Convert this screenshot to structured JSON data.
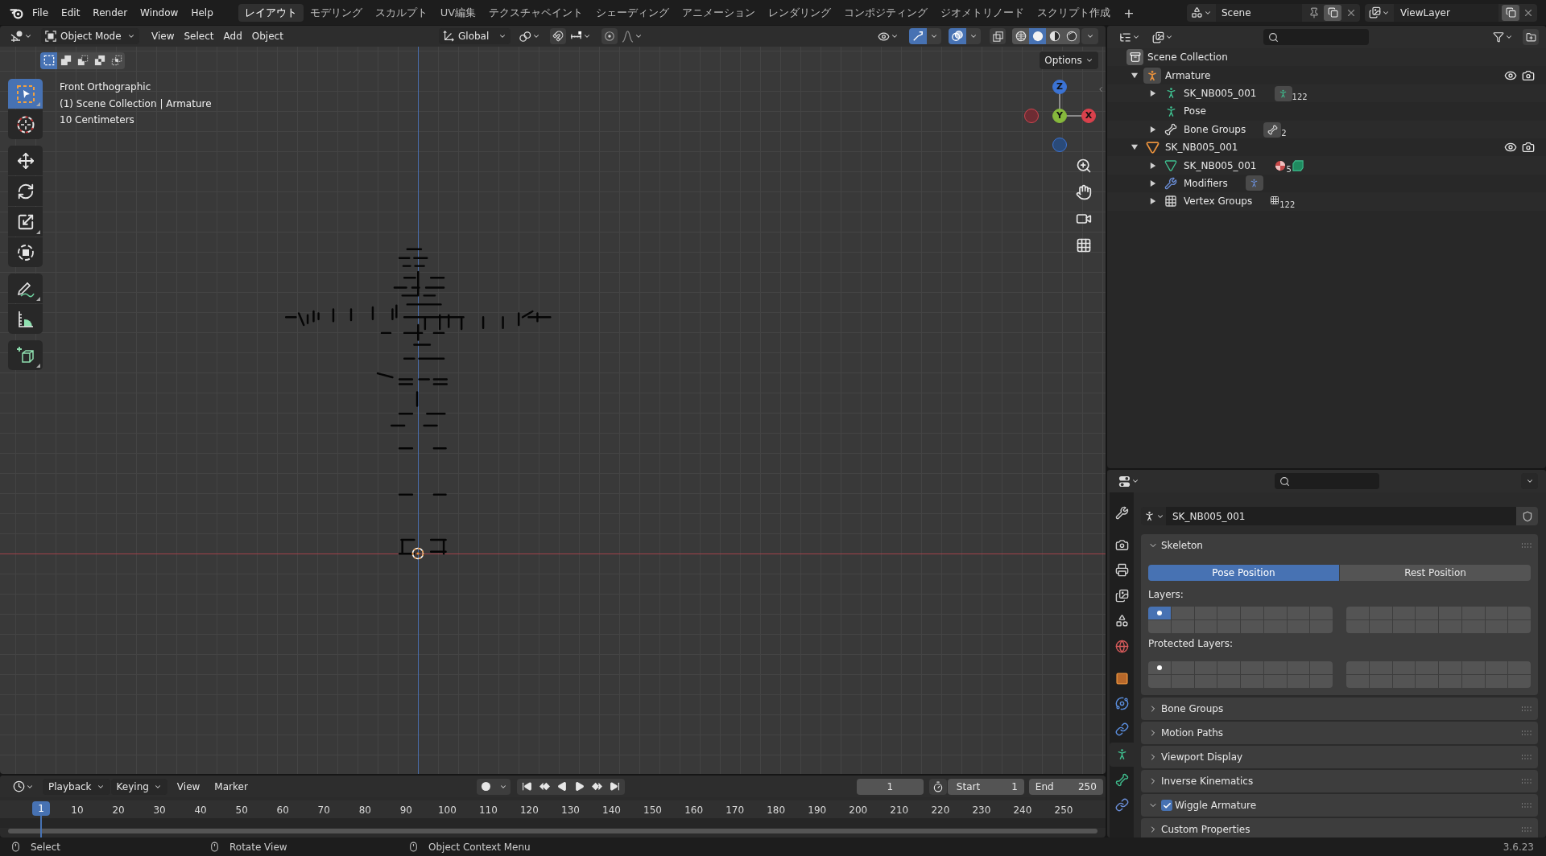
{
  "top_bar": {
    "menus": [
      "File",
      "Edit",
      "Render",
      "Window",
      "Help"
    ],
    "workspaces": [
      {
        "label": "レイアウト",
        "selected": true
      },
      {
        "label": "モデリング",
        "selected": false
      },
      {
        "label": "スカルプト",
        "selected": false
      },
      {
        "label": "UV編集",
        "selected": false
      },
      {
        "label": "テクスチャペイント",
        "selected": false
      },
      {
        "label": "シェーディング",
        "selected": false
      },
      {
        "label": "アニメーション",
        "selected": false
      },
      {
        "label": "レンダリング",
        "selected": false
      },
      {
        "label": "コンポジティング",
        "selected": false
      },
      {
        "label": "ジオメトリノード",
        "selected": false
      },
      {
        "label": "スクリプト作成",
        "selected": false
      }
    ],
    "add_workspace": "+",
    "scene": "Scene",
    "view_layer": "ViewLayer"
  },
  "viewport": {
    "header": {
      "mode": "Object Mode",
      "menus": [
        "View",
        "Select",
        "Add",
        "Object"
      ],
      "orientation": "Global",
      "gizmos_on": true,
      "overlays_on": true,
      "xray_on": false,
      "shading": [
        {
          "kind": "wireframe",
          "selected": false
        },
        {
          "kind": "solid",
          "selected": true
        },
        {
          "kind": "material",
          "selected": false
        },
        {
          "kind": "rendered",
          "selected": false
        }
      ]
    },
    "select_modes": [
      {
        "kind": "set",
        "selected": true
      },
      {
        "kind": "extend",
        "selected": false
      },
      {
        "kind": "subtract",
        "selected": false
      },
      {
        "kind": "invert",
        "selected": false
      },
      {
        "kind": "intersect",
        "selected": false
      }
    ],
    "options": "Options",
    "tool_groups": [
      {
        "tools": [
          {
            "kind": "select_box",
            "selected": true,
            "more": true
          },
          {
            "kind": "cursor",
            "selected": false,
            "more": false
          }
        ]
      },
      {
        "tools": [
          {
            "kind": "move",
            "selected": false,
            "more": false
          },
          {
            "kind": "rotate",
            "selected": false,
            "more": false
          },
          {
            "kind": "scale",
            "selected": false,
            "more": true
          },
          {
            "kind": "transform",
            "selected": false,
            "more": false
          }
        ]
      },
      {
        "tools": [
          {
            "kind": "annotate",
            "selected": false,
            "more": true
          },
          {
            "kind": "measure",
            "selected": false,
            "more": false
          }
        ]
      },
      {
        "tools": [
          {
            "kind": "add_cube",
            "selected": false,
            "more": true
          }
        ]
      }
    ],
    "overlay_text": [
      "Front Orthographic",
      "(1) Scene Collection | Armature",
      "10 Centimeters"
    ],
    "gizmo_axes": [
      {
        "kind": "z",
        "label": "Z"
      },
      {
        "kind": "neg_x"
      },
      {
        "kind": "y",
        "label": "Y"
      },
      {
        "kind": "x",
        "label": "X"
      },
      {
        "kind": "neg_z"
      }
    ]
  },
  "timeline": {
    "menus": [
      {
        "label": "Playback",
        "kind": "dropdown"
      },
      {
        "label": "Keying",
        "kind": "dropdown"
      },
      {
        "label": "View",
        "kind": "plain"
      },
      {
        "label": "Marker",
        "kind": "plain"
      }
    ],
    "auto_keying": false,
    "current_frame": "1",
    "start_label": "Start",
    "start": "1",
    "end_label": "End",
    "end": "250",
    "playhead": "1",
    "ruler_labels": [
      "10",
      "20",
      "30",
      "40",
      "50",
      "60",
      "70",
      "80",
      "90",
      "100",
      "110",
      "120",
      "130",
      "140",
      "150",
      "160",
      "170",
      "180",
      "190",
      "200",
      "210",
      "220",
      "230",
      "240",
      "250"
    ]
  },
  "status_bar": {
    "hints": [
      "Select",
      "Rotate View",
      "Object Context Menu"
    ],
    "version": "3.6.23"
  },
  "outliner": {
    "root": "Scene Collection",
    "items": [
      {
        "kind": "armature_object",
        "name": "Armature",
        "expanded": true,
        "visible": true,
        "renderable": true,
        "children": [
          {
            "kind": "armature_data",
            "name": "SK_NB005_001",
            "expanded": false,
            "badge": "122"
          },
          {
            "kind": "pose",
            "name": "Pose"
          },
          {
            "kind": "bone_groups",
            "name": "Bone Groups",
            "expanded": false,
            "badge": "2"
          }
        ]
      },
      {
        "kind": "mesh_object",
        "name": "SK_NB005_001",
        "expanded": true,
        "visible": true,
        "renderable": true,
        "children": [
          {
            "kind": "mesh_data",
            "name": "SK_NB005_001",
            "expanded": false,
            "badge": "5"
          },
          {
            "kind": "modifiers",
            "name": "Modifiers",
            "expanded": false
          },
          {
            "kind": "vertex_groups",
            "name": "Vertex Groups",
            "expanded": false,
            "badge": "122"
          }
        ]
      }
    ]
  },
  "properties": {
    "tab_groups": [
      {
        "tabs": [
          {
            "kind": "tool",
            "selected": false
          }
        ]
      },
      {
        "tabs": [
          {
            "kind": "render",
            "selected": false
          },
          {
            "kind": "output",
            "selected": false
          },
          {
            "kind": "view_layer",
            "selected": false
          },
          {
            "kind": "scene",
            "selected": false
          },
          {
            "kind": "world",
            "selected": false
          }
        ]
      },
      {
        "tabs": [
          {
            "kind": "object",
            "selected": false
          },
          {
            "kind": "physics",
            "selected": false
          },
          {
            "kind": "object_constraints",
            "selected": false
          },
          {
            "kind": "armature_data",
            "selected": true
          },
          {
            "kind": "bone",
            "selected": false
          },
          {
            "kind": "bone_constraints",
            "selected": false
          }
        ]
      }
    ],
    "data_name": "SK_NB005_001",
    "skeleton": {
      "title": "Skeleton",
      "expanded": true,
      "positions": [
        {
          "label": "Pose Position",
          "selected": true
        },
        {
          "label": "Rest Position",
          "selected": false
        }
      ],
      "layers_label": "Layers:",
      "layers": [
        {
          "on": true,
          "used": true
        },
        {
          "on": false,
          "used": false
        },
        {
          "on": false,
          "used": false
        },
        {
          "on": false,
          "used": false
        },
        {
          "on": false,
          "used": false
        },
        {
          "on": false,
          "used": false
        },
        {
          "on": false,
          "used": false
        },
        {
          "on": false,
          "used": false
        },
        {
          "on": false,
          "used": false
        },
        {
          "on": false,
          "used": false
        },
        {
          "on": false,
          "used": false
        },
        {
          "on": false,
          "used": false
        },
        {
          "on": false,
          "used": false
        },
        {
          "on": false,
          "used": false
        },
        {
          "on": false,
          "used": false
        },
        {
          "on": false,
          "used": false
        },
        {
          "on": false,
          "used": false
        },
        {
          "on": false,
          "used": false
        },
        {
          "on": false,
          "used": false
        },
        {
          "on": false,
          "used": false
        },
        {
          "on": false,
          "used": false
        },
        {
          "on": false,
          "used": false
        },
        {
          "on": false,
          "used": false
        },
        {
          "on": false,
          "used": false
        },
        {
          "on": false,
          "used": false
        },
        {
          "on": false,
          "used": false
        },
        {
          "on": false,
          "used": false
        },
        {
          "on": false,
          "used": false
        },
        {
          "on": false,
          "used": false
        },
        {
          "on": false,
          "used": false
        },
        {
          "on": false,
          "used": false
        },
        {
          "on": false,
          "used": false
        }
      ],
      "protected_label": "Protected Layers:",
      "protected_layers": [
        {
          "on": false,
          "used": true
        },
        {
          "on": false,
          "used": false
        },
        {
          "on": false,
          "used": false
        },
        {
          "on": false,
          "used": false
        },
        {
          "on": false,
          "used": false
        },
        {
          "on": false,
          "used": false
        },
        {
          "on": false,
          "used": false
        },
        {
          "on": false,
          "used": false
        },
        {
          "on": false,
          "used": false
        },
        {
          "on": false,
          "used": false
        },
        {
          "on": false,
          "used": false
        },
        {
          "on": false,
          "used": false
        },
        {
          "on": false,
          "used": false
        },
        {
          "on": false,
          "used": false
        },
        {
          "on": false,
          "used": false
        },
        {
          "on": false,
          "used": false
        },
        {
          "on": false,
          "used": false
        },
        {
          "on": false,
          "used": false
        },
        {
          "on": false,
          "used": false
        },
        {
          "on": false,
          "used": false
        },
        {
          "on": false,
          "used": false
        },
        {
          "on": false,
          "used": false
        },
        {
          "on": false,
          "used": false
        },
        {
          "on": false,
          "used": false
        },
        {
          "on": false,
          "used": false
        },
        {
          "on": false,
          "used": false
        },
        {
          "on": false,
          "used": false
        },
        {
          "on": false,
          "used": false
        },
        {
          "on": false,
          "used": false
        },
        {
          "on": false,
          "used": false
        },
        {
          "on": false,
          "used": false
        },
        {
          "on": false,
          "used": false
        }
      ]
    },
    "panels": [
      {
        "kind": "plain",
        "title": "Bone Groups",
        "expanded": false
      },
      {
        "kind": "plain",
        "title": "Motion Paths",
        "expanded": false
      },
      {
        "kind": "plain",
        "title": "Viewport Display",
        "expanded": false
      },
      {
        "kind": "plain",
        "title": "Inverse Kinematics",
        "expanded": false
      },
      {
        "kind": "checkbox",
        "title": "Wiggle Armature",
        "expanded": true,
        "checked": true
      },
      {
        "kind": "plain",
        "title": "Custom Properties",
        "expanded": false
      }
    ]
  }
}
